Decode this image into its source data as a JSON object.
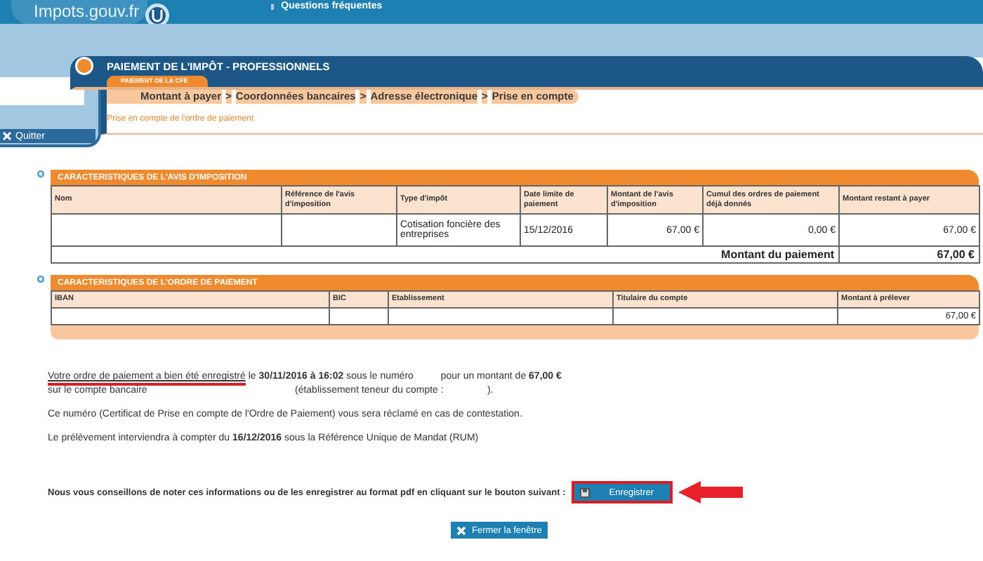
{
  "header": {
    "logo": "Impots.gouv.fr",
    "links": [
      "Questions fréquentes"
    ],
    "title": "PAIEMENT DE L'IMPÔT - PROFESSIONNELS",
    "tab": "PAIEMENT DE LA CFE"
  },
  "sidebar": {
    "quit": "Quitter"
  },
  "breadcrumb": {
    "separator": ">",
    "steps": [
      "Montant à payer",
      "Coordonnées bancaires",
      "Adresse électronique",
      "Prise en compte"
    ]
  },
  "page_title": "Prise en compte de l'ordre de paiement",
  "tax_notice": {
    "title": "CARACTERISTIQUES DE L'AVIS D'IMPOSITION",
    "columns": [
      "Nom",
      "Référence de l'avis d'imposition",
      "Type d'impôt",
      "Date limite de paiement",
      "Montant de l'avis d'imposition",
      "Cumul des ordres de paiement déjà donnés",
      "Montant restant à payer"
    ],
    "rows": [
      [
        "",
        "",
        "Cotisation foncière des entreprises",
        "15/12/2016",
        "67,00 €",
        "0,00 €",
        "67,00 €"
      ]
    ],
    "total_label": "Montant du paiement",
    "total_value": "67,00 €"
  },
  "payment_order": {
    "title": "CARACTERISTIQUES DE L'ORDRE DE PAIEMENT",
    "columns": [
      "IBAN",
      "BIC",
      "Etablissement",
      "Titulaire du compte",
      "Montant à prélever"
    ],
    "rows": [
      [
        "",
        "",
        "",
        "",
        "67,00 €"
      ]
    ]
  },
  "confirmation": {
    "highlight": "Votre ordre de paiement a bien été enregistré",
    "line1_rest": "le **30/11/2016 à 16:02** sous le numéro",
    "line1_end": "pour un montant de **67,00 €**",
    "line2_start": "sur le compte bancaire",
    "line2_mid": "(établissement teneur du compte :",
    "line2_end": ")."
  },
  "paragraphs": [
    "Ce numéro (Certificat de Prise en compte de l'Ordre de Paiement) vous sera réclamé en cas de contestation.",
    "Le prélèvement interviendra à compter du **16/12/2016** sous la Référence Unique de Mandat (RUM)"
  ],
  "advice": "Nous vous conseillons de noter ces informations ou de les enregistrer au format pdf en cliquant sur le bouton suivant :",
  "buttons": [
    {
      "kind": "save",
      "label": "Enregistrer"
    },
    {
      "kind": "close",
      "label": "Fermer la fenêtre"
    }
  ]
}
